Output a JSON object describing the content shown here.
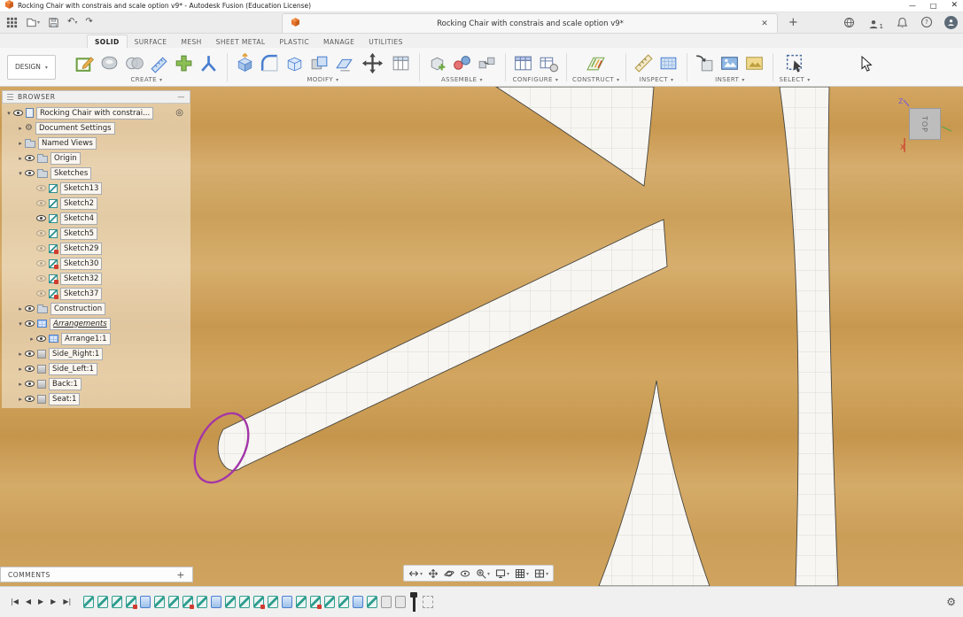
{
  "titlebar": {
    "title": "Rocking Chair with constrais and scale option v9* - Autodesk Fusion (Education License)",
    "minimize_glyph": "—",
    "maximize_glyph": "□",
    "close_glyph": "✕"
  },
  "tabbar": {
    "tab_title": "Rocking Chair with constrais and scale option v9*",
    "tab_close_glyph": "✕",
    "new_tab_glyph": "+",
    "undo_glyph": "↶",
    "redo_glyph": "↷",
    "presence_count": "1",
    "help_glyph": "?"
  },
  "ribbon": {
    "design_label": "DESIGN",
    "tabs": [
      {
        "label": "SOLID",
        "active": true
      },
      {
        "label": "SURFACE",
        "active": false
      },
      {
        "label": "MESH",
        "active": false
      },
      {
        "label": "SHEET METAL",
        "active": false
      },
      {
        "label": "PLASTIC",
        "active": false
      },
      {
        "label": "MANAGE",
        "active": false
      },
      {
        "label": "UTILITIES",
        "active": false
      }
    ],
    "groups": [
      {
        "label": "CREATE"
      },
      {
        "label": "MODIFY"
      },
      {
        "label": "ASSEMBLE"
      },
      {
        "label": "CONFIGURE"
      },
      {
        "label": "CONSTRUCT"
      },
      {
        "label": "INSPECT"
      },
      {
        "label": "INSERT"
      },
      {
        "label": "SELECT"
      }
    ]
  },
  "browser": {
    "header": "BROWSER",
    "collapse_glyph": "—",
    "items": [
      {
        "level": 0,
        "disc": "open",
        "eye": "on",
        "icon": "doc",
        "label": "Rocking Chair with constrai...",
        "trailing": "target"
      },
      {
        "level": 1,
        "disc": "closed",
        "eye": null,
        "icon": "gear",
        "label": "Document Settings"
      },
      {
        "level": 1,
        "disc": "closed",
        "eye": null,
        "icon": "folder",
        "label": "Named Views"
      },
      {
        "level": 1,
        "disc": "closed",
        "eye": "on",
        "icon": "folder",
        "label": "Origin"
      },
      {
        "level": 1,
        "disc": "open",
        "eye": "on",
        "icon": "folder",
        "label": "Sketches"
      },
      {
        "level": 2,
        "disc": "",
        "eye": "off",
        "icon": "sketch",
        "label": "Sketch13"
      },
      {
        "level": 2,
        "disc": "",
        "eye": "off",
        "icon": "sketch",
        "label": "Sketch2"
      },
      {
        "level": 2,
        "disc": "",
        "eye": "on",
        "icon": "sketch",
        "label": "Sketch4"
      },
      {
        "level": 2,
        "disc": "",
        "eye": "off",
        "icon": "sketch",
        "label": "Sketch5"
      },
      {
        "level": 2,
        "disc": "",
        "eye": "off",
        "icon": "sketch-locked",
        "label": "Sketch29"
      },
      {
        "level": 2,
        "disc": "",
        "eye": "off",
        "icon": "sketch-locked",
        "label": "Sketch30"
      },
      {
        "level": 2,
        "disc": "",
        "eye": "off",
        "icon": "sketch-locked",
        "label": "Sketch32"
      },
      {
        "level": 2,
        "disc": "",
        "eye": "off",
        "icon": "sketch-locked",
        "label": "Sketch37"
      },
      {
        "level": 1,
        "disc": "closed",
        "eye": "on",
        "icon": "folder",
        "label": "Construction"
      },
      {
        "level": 1,
        "disc": "open",
        "eye": "on",
        "icon": "arrangement",
        "label": "Arrangements",
        "style": "edited"
      },
      {
        "level": 2,
        "disc": "closed",
        "eye": "on",
        "icon": "arrange",
        "label": "Arrange1:1"
      },
      {
        "level": 1,
        "disc": "closed",
        "eye": "on",
        "icon": "component",
        "label": "Side_Right:1"
      },
      {
        "level": 1,
        "disc": "closed",
        "eye": "on",
        "icon": "component",
        "label": "Side_Left:1"
      },
      {
        "level": 1,
        "disc": "closed",
        "eye": "on",
        "icon": "component",
        "label": "Back:1"
      },
      {
        "level": 1,
        "disc": "closed",
        "eye": "on",
        "icon": "component",
        "label": "Seat:1"
      }
    ]
  },
  "viewcube": {
    "face_label": "TOP",
    "axis_z": "Z",
    "axis_x": "X"
  },
  "comments": {
    "label": "COMMENTS",
    "add_glyph": "+"
  },
  "navbar": {
    "buttons": [
      {
        "name": "fit",
        "caret": true
      },
      {
        "name": "pan",
        "caret": false
      },
      {
        "name": "orbit",
        "caret": false
      },
      {
        "name": "look-at",
        "caret": false
      },
      {
        "name": "zoom",
        "caret": true
      },
      {
        "name": "display-settings",
        "caret": true
      },
      {
        "name": "grid-settings",
        "caret": true
      },
      {
        "name": "viewports",
        "caret": true
      }
    ]
  },
  "timeline": {
    "playback": [
      {
        "name": "go-to-start",
        "glyph": "|◀"
      },
      {
        "name": "step-back",
        "glyph": "◀"
      },
      {
        "name": "play",
        "glyph": "▶"
      },
      {
        "name": "step-forward",
        "glyph": "▶"
      },
      {
        "name": "go-to-end",
        "glyph": "▶|"
      }
    ],
    "icons": [
      "sketch",
      "sketch",
      "sketch",
      "sketch-locked",
      "plane",
      "sketch",
      "sketch",
      "sketch-locked",
      "sketch",
      "plane",
      "sketch",
      "sketch",
      "sketch-locked",
      "sketch",
      "plane",
      "sketch",
      "sketch-locked",
      "sketch",
      "sketch",
      "plane",
      "sketch",
      "feature",
      "feature"
    ],
    "settings_glyph": "⚙"
  },
  "colors": {
    "accent_orange": "#e8762d",
    "wood_base": "#cfa25c",
    "sketch_white": "#f7f6f2",
    "spline_purple": "#a335a8",
    "feature_teal": "#2f9d8f",
    "feature_blue": "#4a7fd0"
  }
}
